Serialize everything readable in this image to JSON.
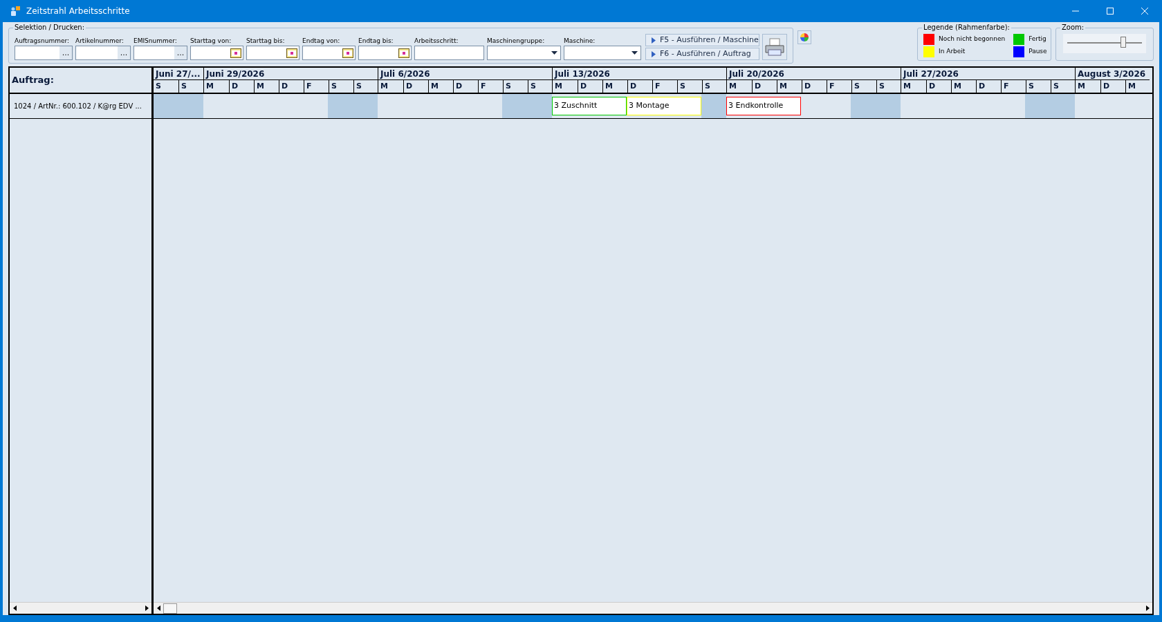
{
  "window": {
    "title": "Zeitstrahl Arbeitsschritte"
  },
  "selection": {
    "title": "Selektion / Drucken:",
    "filters": [
      {
        "label": "Auftragsnummer:",
        "kind": "lookup",
        "button": "..."
      },
      {
        "label": "Artikelnummer:",
        "kind": "lookup",
        "button": "..."
      },
      {
        "label": "EMISnummer:",
        "kind": "lookup",
        "button": "..."
      },
      {
        "label": "Starttag von:",
        "kind": "date"
      },
      {
        "label": "Starttag bis:",
        "kind": "date"
      },
      {
        "label": "Endtag von:",
        "kind": "date"
      },
      {
        "label": "Endtag bis:",
        "kind": "date"
      },
      {
        "label": "Arbeitsschritt:",
        "kind": "text"
      },
      {
        "label": "Maschinengruppe:",
        "kind": "combo"
      },
      {
        "label": "Maschine:",
        "kind": "combo"
      }
    ],
    "buttons": [
      "F5 - Ausführen / Maschine",
      "F6 - Ausführen / Auftrag"
    ]
  },
  "legend": {
    "title": "Legende (Rahmenfarbe):",
    "items": [
      {
        "label": "Noch nicht begonnen",
        "color": "#ff0000"
      },
      {
        "label": "Fertig",
        "color": "#00c800"
      },
      {
        "label": "In Arbeit",
        "color": "#ffff00"
      },
      {
        "label": "Pause",
        "color": "#0000ff"
      }
    ]
  },
  "zoom": {
    "title": "Zoom:",
    "level": 0.75
  },
  "left_header": "Auftrag:",
  "weeks": [
    {
      "label": "Juni 27/...",
      "days": [
        "S",
        "S"
      ]
    },
    {
      "label": "Juni 29/2026",
      "days": [
        "M",
        "D",
        "M",
        "D",
        "F",
        "S",
        "S"
      ]
    },
    {
      "label": "Juli 6/2026",
      "days": [
        "M",
        "D",
        "M",
        "D",
        "F",
        "S",
        "S"
      ]
    },
    {
      "label": "Juli 13/2026",
      "days": [
        "M",
        "D",
        "M",
        "D",
        "F",
        "S",
        "S"
      ]
    },
    {
      "label": "Juli 20/2026",
      "days": [
        "M",
        "D",
        "M",
        "D",
        "F",
        "S",
        "S"
      ]
    },
    {
      "label": "Juli 27/2026",
      "days": [
        "M",
        "D",
        "M",
        "D",
        "F",
        "S",
        "S"
      ]
    },
    {
      "label": "August 3/2026",
      "days": [
        "M",
        "D",
        "M"
      ]
    }
  ],
  "rows": [
    {
      "label": "1024 / ArtNr.: 600.102 / K@rg EDV ...",
      "cells": [
        {
          "kind": "weekend"
        },
        {
          "kind": "weekend"
        },
        {
          "kind": "workday"
        },
        {
          "kind": "workday"
        },
        {
          "kind": "workday"
        },
        {
          "kind": "workday"
        },
        {
          "kind": "workday"
        },
        {
          "kind": "weekend"
        },
        {
          "kind": "weekend"
        },
        {
          "kind": "workday"
        },
        {
          "kind": "workday"
        },
        {
          "kind": "workday"
        },
        {
          "kind": "workday"
        },
        {
          "kind": "workday"
        },
        {
          "kind": "weekend"
        },
        {
          "kind": "weekend"
        },
        {
          "kind": "task3",
          "label": "3 Zuschnitt",
          "color": "#00c800"
        },
        {
          "kind": "task3",
          "label": "3 Montage",
          "color": "#ffff00"
        },
        {
          "kind": "weekend"
        },
        {
          "kind": "task3",
          "label": "3 Endkontrolle",
          "color": "#ff0000"
        },
        {
          "kind": "workday"
        },
        {
          "kind": "workday"
        },
        {
          "kind": "weekend"
        },
        {
          "kind": "weekend"
        },
        {
          "kind": "workday"
        },
        {
          "kind": "workday"
        },
        {
          "kind": "workday"
        },
        {
          "kind": "workday"
        },
        {
          "kind": "workday"
        },
        {
          "kind": "weekend"
        },
        {
          "kind": "weekend"
        },
        {
          "kind": "workday"
        },
        {
          "kind": "workday"
        },
        {
          "kind": "workday"
        }
      ]
    }
  ]
}
